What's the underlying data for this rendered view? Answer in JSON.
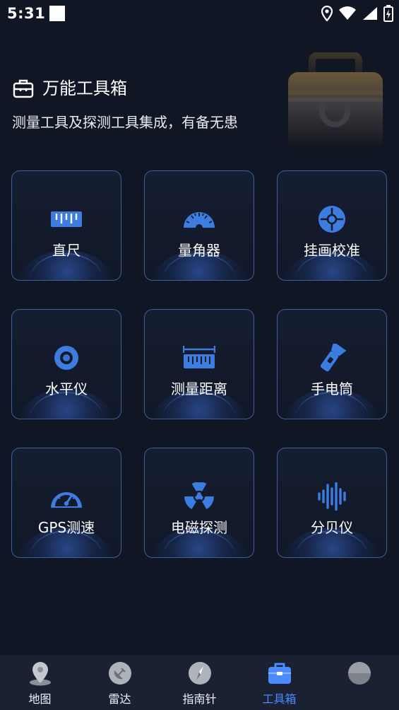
{
  "status_bar": {
    "time": "5:31",
    "icons": [
      "location-icon",
      "wifi-icon",
      "signal-icon",
      "battery-charging-icon"
    ]
  },
  "header": {
    "title": "万能工具箱",
    "subtitle": "测量工具及探测工具集成，有备无患",
    "icon": "toolbox-icon"
  },
  "tools": [
    {
      "label": "直尺",
      "icon": "ruler-icon"
    },
    {
      "label": "量角器",
      "icon": "protractor-icon"
    },
    {
      "label": "挂画校准",
      "icon": "crosshair-icon"
    },
    {
      "label": "水平仪",
      "icon": "level-icon"
    },
    {
      "label": "测量距离",
      "icon": "distance-ruler-icon"
    },
    {
      "label": "手电筒",
      "icon": "flashlight-icon"
    },
    {
      "label": "GPS测速",
      "icon": "speedometer-icon"
    },
    {
      "label": "电磁探测",
      "icon": "radiation-icon"
    },
    {
      "label": "分贝仪",
      "icon": "sound-wave-icon"
    }
  ],
  "bottom_nav": {
    "active_index": 3,
    "items": [
      {
        "label": "地图",
        "icon": "map-pin-icon"
      },
      {
        "label": "雷达",
        "icon": "radar-icon"
      },
      {
        "label": "指南针",
        "icon": "compass-icon"
      },
      {
        "label": "工具箱",
        "icon": "toolbox-icon"
      },
      {
        "label": "",
        "icon": "profile-icon"
      }
    ]
  },
  "colors": {
    "background": "#101624",
    "card_border": "#3f5f98",
    "icon_blue": "#3d7de0",
    "active_nav": "#4a8cff",
    "nav_background": "#1a2133"
  }
}
